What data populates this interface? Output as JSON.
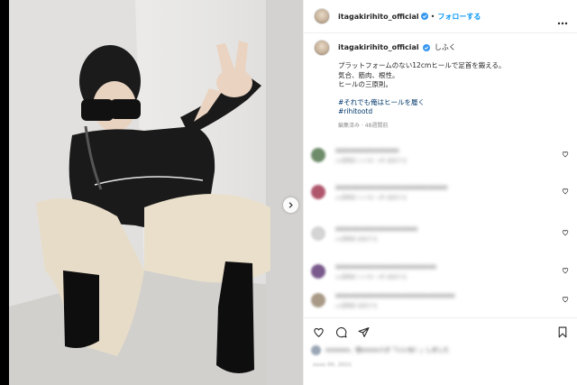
{
  "post": {
    "username": "itagakirihito_official",
    "follow_label": "フォローする",
    "caption_username": "itagakirihito_official",
    "caption_tail": "しふく",
    "caption_lines": [
      "プラットフォームのない12cmヒールで足首を鍛える。",
      "気合、筋肉、根性。",
      "ヒールの三原則。"
    ],
    "hashtags": [
      "#それでも俺はヒールを履く",
      "#rihitootd"
    ],
    "meta": "編集済み · 48週間前"
  },
  "comments": [
    {
      "user": "xxxxx_xxxxxx",
      "text": "xxxxxxxxxxxxxxxxx",
      "sub": "xx週間前  いいね！x件  返信する"
    },
    {
      "user": "xxxxxxxxxxxxxx_xxxx",
      "text": "xxxxxxxxxxxxxxxxxxxxxxxxxxxxxx",
      "sub": "xx週間前  いいね！x件  返信する"
    },
    {
      "user": "xxxxxxx",
      "text": "xxxxxxxxxxxxxxxxxxxxxx",
      "sub": "xx週間前  返信する"
    },
    {
      "user": "xxxxxxxxxxx",
      "text": "xxxxxxxxxxxxxxxxxxxxxxxxxxx",
      "sub": "xx週間前  いいね！x件  返信する"
    },
    {
      "user": "xxxxxxxxx",
      "text": "xxxxxxxxxxxxxxxxxxxxxxxxxxxxxxxx",
      "sub": "xx週間前  返信する"
    }
  ],
  "likes": {
    "text": "xxxxxxx、他xxxxx人が「いいね！」しました"
  },
  "date": "xxxx 00, 2021",
  "colors": {
    "accent": "#0095f6",
    "verified": "#3897f0",
    "hashtag": "#00376b",
    "muted": "#8e8e8e"
  },
  "icons": [
    "verified-badge-icon",
    "more-options-icon",
    "heart-icon",
    "comment-icon",
    "share-icon",
    "bookmark-icon",
    "chevron-right-icon"
  ]
}
